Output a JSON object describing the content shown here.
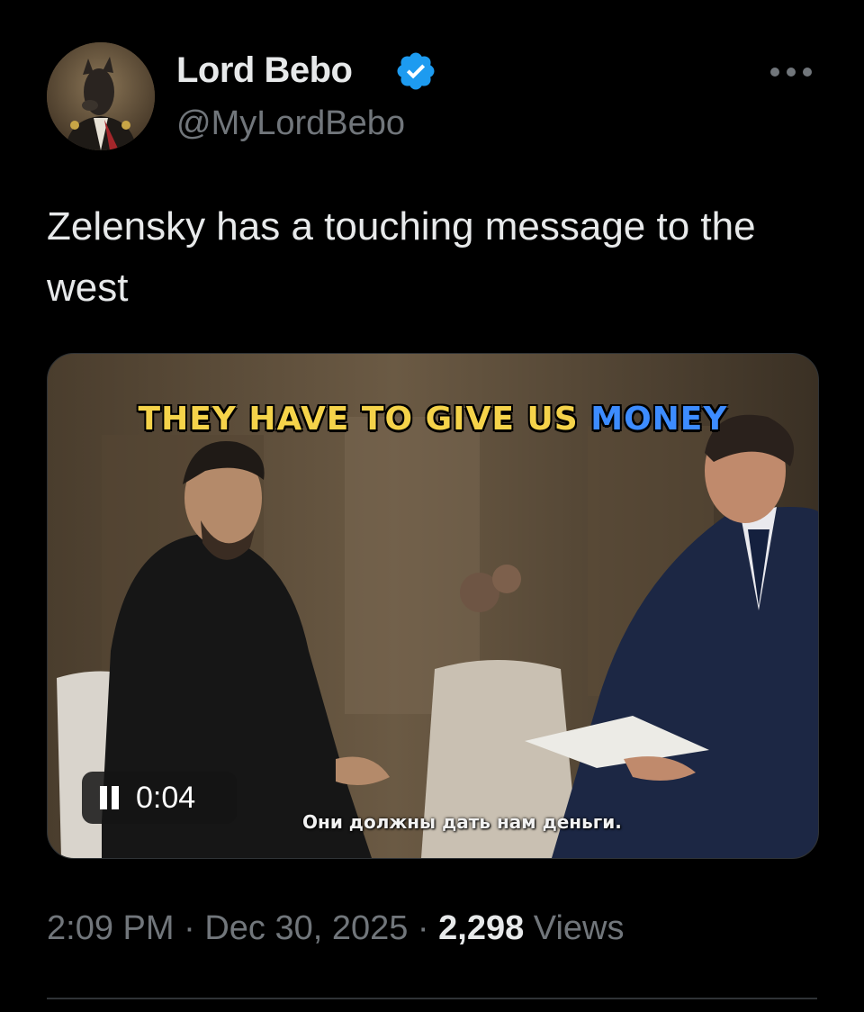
{
  "author": {
    "display_name": "Lord Bebo",
    "handle": "@MyLordBebo",
    "avatar_icon": "dog-in-uniform-portrait",
    "verified_icon": "verified-badge-icon",
    "verified_color": "#1d9bf0"
  },
  "more_icon": "more-horizontal-icon",
  "tweet": {
    "text": "Zelensky has a touching message to the west"
  },
  "media": {
    "caption_main": "THEY HAVE TO GIVE US ",
    "caption_accent": "MONEY",
    "caption_color": "#f5d34a",
    "caption_accent_color": "#3d8cff",
    "subtitle": "Они должны дать нам деньги.",
    "timer": "0:04",
    "pause_icon": "pause-icon"
  },
  "meta": {
    "time": "2:09 PM",
    "separator": " · ",
    "date": "Dec 30, 2025",
    "views_count": "2,298",
    "views_label": " Views"
  }
}
